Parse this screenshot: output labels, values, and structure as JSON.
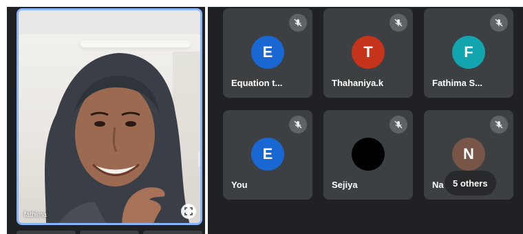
{
  "pinned": {
    "name": "fathima"
  },
  "tiles": [
    {
      "name": "Equation t...",
      "initial": "E",
      "color": "#1967d2"
    },
    {
      "name": "Thahaniya.k",
      "initial": "T",
      "color": "#c5341a"
    },
    {
      "name": "Fathima S...",
      "initial": "F",
      "color": "#12a4af"
    },
    {
      "name": "You",
      "initial": "E",
      "color": "#1967d2"
    },
    {
      "name": "Sejiya",
      "initial": "",
      "color": "#000000"
    },
    {
      "name": "Na",
      "initial": "N",
      "color": "#795548"
    }
  ],
  "others_label": "5 others",
  "icons": {
    "mute": "mic-off-icon",
    "expand": "expand-icon"
  },
  "colors": {
    "background": "#202124",
    "tile": "#3c4043",
    "pinned_border": "#8ab4f8"
  }
}
